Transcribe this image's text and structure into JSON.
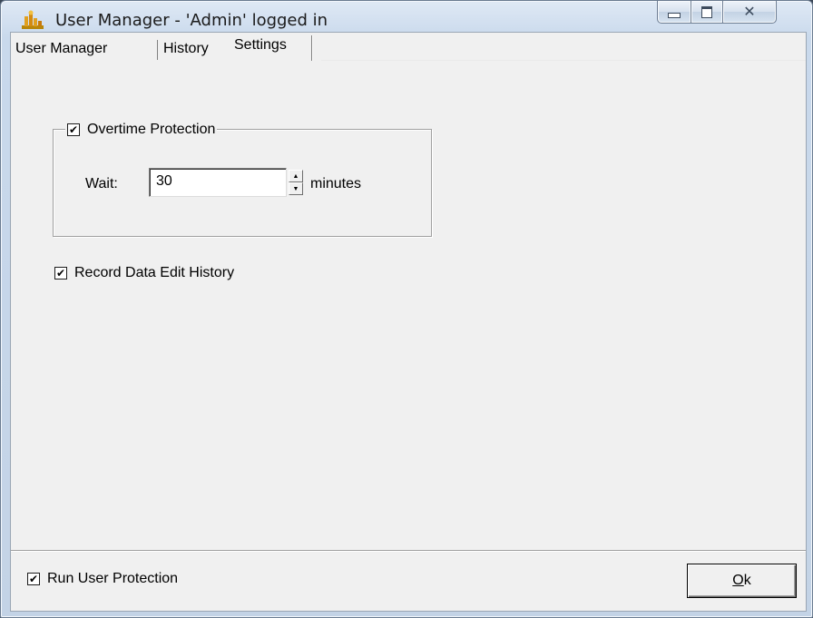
{
  "window": {
    "title": "User Manager - 'Admin' logged in"
  },
  "tabs": [
    {
      "label": "User Manager",
      "selected": false
    },
    {
      "label": "History",
      "selected": false
    },
    {
      "label": "Settings",
      "selected": true
    }
  ],
  "settings": {
    "overtime_protection": {
      "label": "Overtime Protection",
      "checked": true,
      "wait_label": "Wait:",
      "wait_value": "30",
      "unit_label": "minutes"
    },
    "record_history": {
      "label": "Record Data Edit History",
      "checked": true
    }
  },
  "footer": {
    "run_protection": {
      "label": "Run User Protection",
      "checked": true
    },
    "ok_accel": "O",
    "ok_rest": "k"
  }
}
